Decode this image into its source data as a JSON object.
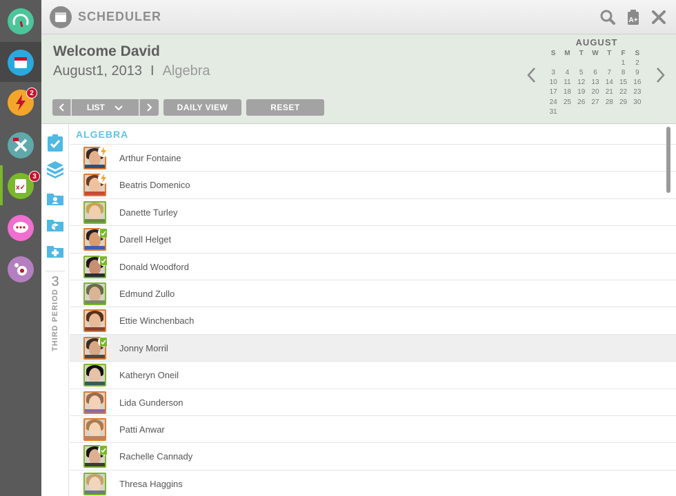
{
  "rail": {
    "apps": [
      {
        "name": "gauge-app-icon",
        "color": "#4cc59a"
      },
      {
        "name": "scheduler-app-icon",
        "color": "#2aa9df"
      },
      {
        "name": "alerts-app-icon",
        "color": "#f4a62a",
        "badge": "2"
      },
      {
        "name": "tools-app-icon",
        "color": "#5fa9ab"
      },
      {
        "name": "assignments-app-icon",
        "color": "#7ab82c",
        "badge": "3"
      },
      {
        "name": "messages-app-icon",
        "color": "#f06ed0"
      },
      {
        "name": "settings-app-icon",
        "color": "#b47fc0"
      }
    ]
  },
  "header": {
    "title": "SCHEDULER"
  },
  "info": {
    "welcome": "Welcome David",
    "date": "August1, 2013",
    "separator": "I",
    "course": "Algebra"
  },
  "controls": {
    "list_label": "LIST",
    "daily_view_label": "DAILY VIEW",
    "reset_label": "RESET"
  },
  "calendar": {
    "month": "AUGUST",
    "weekdays": [
      "S",
      "M",
      "T",
      "W",
      "T",
      "F",
      "S"
    ],
    "weeks": [
      [
        "",
        "",
        "",
        "",
        "",
        "1",
        "2"
      ],
      [
        "3",
        "4",
        "5",
        "6",
        "7",
        "8",
        "9"
      ],
      [
        "10",
        "11",
        "12",
        "13",
        "14",
        "15",
        "16"
      ],
      [
        "17",
        "18",
        "19",
        "20",
        "21",
        "22",
        "23"
      ],
      [
        "24",
        "25",
        "26",
        "27",
        "28",
        "29",
        "30"
      ],
      [
        "31",
        "",
        "",
        "",
        "",
        "",
        ""
      ]
    ]
  },
  "side": {
    "period_number": "3",
    "period_label": "THIRD PERIOD"
  },
  "list": {
    "section": "ALGEBRA",
    "students": [
      {
        "name": "Arthur Fontaine",
        "frame": "orange",
        "status": "bolt",
        "hair": "#3b2a1e",
        "skin": "#e2b08c",
        "shirt": "#2d4f7a"
      },
      {
        "name": "Beatris Domenico",
        "frame": "orange",
        "status": "bolt",
        "hair": "#6b3b22",
        "skin": "#eec1a0",
        "shirt": "#c44b3a"
      },
      {
        "name": "Danette Turley",
        "frame": "green",
        "status": "",
        "hair": "#c9a25a",
        "skin": "#f0cfae",
        "shirt": "#6b8a4a"
      },
      {
        "name": "Darell Helget",
        "frame": "orange",
        "status": "clipboard",
        "hair": "#2b1f1a",
        "skin": "#d89c74",
        "shirt": "#3d5fb0"
      },
      {
        "name": "Donald Woodford",
        "frame": "green",
        "status": "clipboard",
        "hair": "#1c1a18",
        "skin": "#c89070",
        "shirt": "#2c2c2c"
      },
      {
        "name": "Edmund Zullo",
        "frame": "green",
        "status": "",
        "hair": "#6a6a4a",
        "skin": "#d9b596",
        "shirt": "#7a8a6a"
      },
      {
        "name": "Ettie Winchenbach",
        "frame": "orange",
        "status": "",
        "hair": "#5a3018",
        "skin": "#e8bb98",
        "shirt": "#8a4030"
      },
      {
        "name": "Jonny Morril",
        "frame": "orange",
        "status": "clipboard",
        "hair": "#3e2c22",
        "skin": "#d8a884",
        "shirt": "#4a4a4a",
        "highlight": true
      },
      {
        "name": "Katheryn Oneil",
        "frame": "green",
        "status": "",
        "hair": "#121212",
        "skin": "#e6c2a6",
        "shirt": "#2f5e56"
      },
      {
        "name": "Lida Gunderson",
        "frame": "orange",
        "status": "",
        "hair": "#9a6a4a",
        "skin": "#f2d2b8",
        "shirt": "#8a6aa8"
      },
      {
        "name": "Patti Anwar",
        "frame": "orange",
        "status": "",
        "hair": "#b07a48",
        "skin": "#f4d4b6",
        "shirt": "#c08060"
      },
      {
        "name": "Rachelle Cannady",
        "frame": "green",
        "status": "clipboard",
        "hair": "#1a1614",
        "skin": "#dcb090",
        "shirt": "#3a3a3a"
      },
      {
        "name": "Thresa Haggins",
        "frame": "green",
        "status": "",
        "hair": "#c4a26e",
        "skin": "#f2d6bc",
        "shirt": "#6a7a8a"
      }
    ]
  }
}
